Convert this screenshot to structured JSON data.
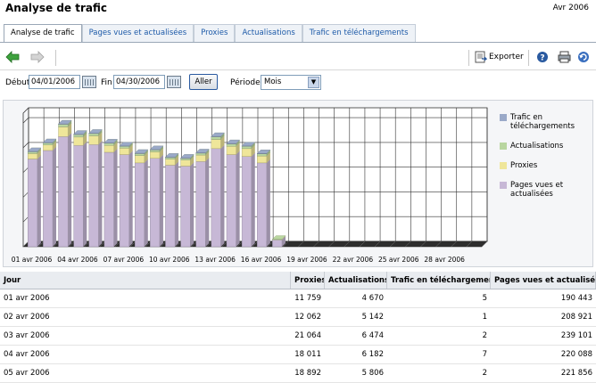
{
  "header": {
    "title": "Analyse de trafic",
    "date": "Avr 2006"
  },
  "tabs": [
    {
      "label": "Analyse de trafic",
      "active": true
    },
    {
      "label": "Pages vues et actualisées",
      "active": false
    },
    {
      "label": "Proxies",
      "active": false
    },
    {
      "label": "Actualisations",
      "active": false
    },
    {
      "label": "Trafic en téléchargements",
      "active": false
    }
  ],
  "toolbar": {
    "back_icon": "back-arrow-icon",
    "forward_icon": "forward-arrow-icon",
    "export_label": "Exporter",
    "help_icon": "help-icon",
    "print_icon": "print-icon",
    "refresh_icon": "refresh-icon"
  },
  "filters": {
    "start_label": "Début",
    "start_value": "04/01/2006",
    "end_label": "Fin",
    "end_value": "04/30/2006",
    "go_label": "Aller",
    "period_label": "Période",
    "period_value": "Mois"
  },
  "colors": {
    "pages": "#c7b8d6",
    "proxies": "#efe69a",
    "actualisations": "#b9d6a0",
    "telechargements": "#9aa9c8"
  },
  "chart_data": {
    "type": "bar",
    "stacked": true,
    "x_tick_labels": [
      "01 avr 2006",
      "04 avr 2006",
      "07 avr 2006",
      "10 avr 2006",
      "13 avr 2006",
      "16 avr 2006",
      "19 avr 2006",
      "22 avr 2006",
      "25 avr 2006",
      "28 avr 2006"
    ],
    "days": 30,
    "legend": [
      "Trafic en téléchargements",
      "Actualisations",
      "Proxies",
      "Pages vues et actualisées"
    ],
    "legend_position": "right",
    "series": [
      {
        "name": "Pages vues et actualisées",
        "values": [
          190443,
          208921,
          239101,
          220088,
          221856,
          205000,
          200000,
          182000,
          192000,
          177000,
          175000,
          185000,
          213000,
          200000,
          196000,
          182000,
          15000,
          0,
          0,
          0,
          0,
          0,
          0,
          0,
          0,
          0,
          0,
          0,
          0,
          0
        ]
      },
      {
        "name": "Proxies",
        "values": [
          11759,
          12062,
          21064,
          18011,
          18892,
          15000,
          14000,
          16000,
          14000,
          13000,
          13000,
          14000,
          20000,
          18000,
          17000,
          15000,
          1000,
          0,
          0,
          0,
          0,
          0,
          0,
          0,
          0,
          0,
          0,
          0,
          0,
          0
        ]
      },
      {
        "name": "Actualisations",
        "values": [
          4670,
          5142,
          6474,
          6182,
          5806,
          5500,
          5000,
          5000,
          5000,
          4500,
          4500,
          5000,
          6500,
          6000,
          6000,
          5500,
          300,
          0,
          0,
          0,
          0,
          0,
          0,
          0,
          0,
          0,
          0,
          0,
          0,
          0
        ]
      },
      {
        "name": "Trafic en téléchargements",
        "values": [
          5,
          1,
          2,
          7,
          2,
          3,
          2,
          2,
          2,
          2,
          2,
          2,
          3,
          2,
          2,
          2,
          0,
          0,
          0,
          0,
          0,
          0,
          0,
          0,
          0,
          0,
          0,
          0,
          0,
          0
        ]
      }
    ],
    "ylim": [
      0,
      290000
    ],
    "grid": true
  },
  "table": {
    "columns": [
      "Jour",
      "Proxies",
      "Actualisations",
      "Trafic en téléchargements",
      "Pages vues et actualisées"
    ],
    "rows": [
      [
        "01 avr 2006",
        "11 759",
        "4 670",
        "5",
        "190 443"
      ],
      [
        "02 avr 2006",
        "12 062",
        "5 142",
        "1",
        "208 921"
      ],
      [
        "03 avr 2006",
        "21 064",
        "6 474",
        "2",
        "239 101"
      ],
      [
        "04 avr 2006",
        "18 011",
        "6 182",
        "7",
        "220 088"
      ],
      [
        "05 avr 2006",
        "18 892",
        "5 806",
        "2",
        "221 856"
      ]
    ]
  }
}
